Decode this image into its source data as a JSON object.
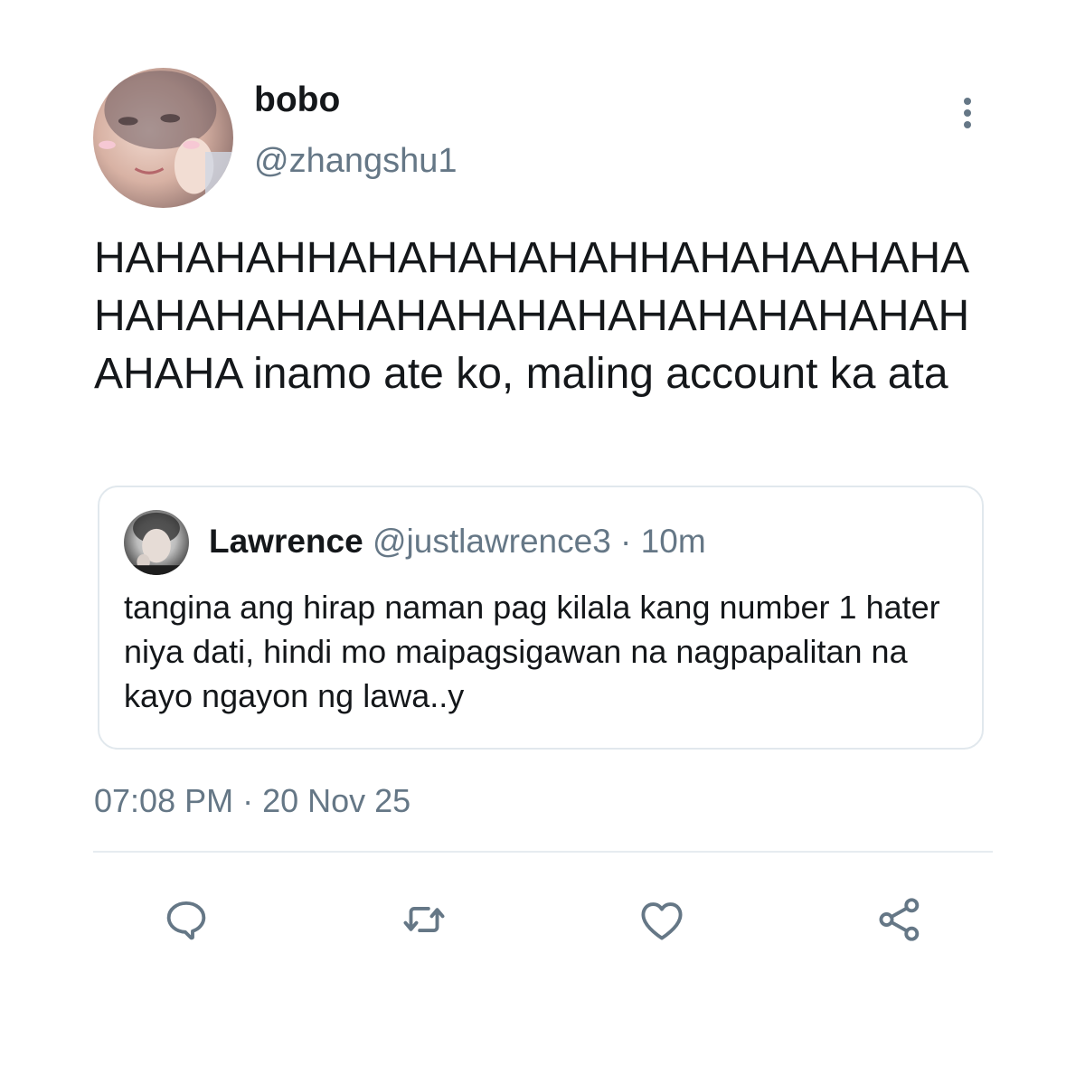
{
  "tweet": {
    "author": {
      "display_name": "bobo",
      "handle": "@zhangshu1"
    },
    "text": "HAHAHAHHAHAHAHAHAHHAHAHAAHAHAHAHAHAHAHAHAHAHAHAHAHAHAHAHAHAHAHA inamo ate ko, maling account ka ata",
    "timestamp": "07:08 PM · 20 Nov 25"
  },
  "quoted_tweet": {
    "display_name": "Lawrence",
    "handle": "@justlawrence3",
    "separator": " · ",
    "time_ago": "10m",
    "text": "tangina ang hirap naman pag kilala kang number 1 hater niya dati, hindi mo maipagsigawan na nagpapalitan na kayo ngayon ng lawa..y"
  },
  "actions": {
    "reply_icon": "reply-icon",
    "retweet_icon": "retweet-icon",
    "like_icon": "heart-icon",
    "share_icon": "share-icon"
  },
  "colors": {
    "text_primary": "#14171a",
    "text_secondary": "#657786",
    "border": "#e1e8ed",
    "icon": "#657786"
  }
}
